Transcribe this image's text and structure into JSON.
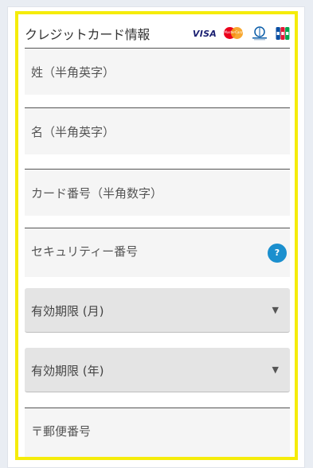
{
  "form": {
    "title": "クレジットカード情報",
    "card_brands": [
      "VISA",
      "MasterCard",
      "Diners Club",
      "JCB"
    ],
    "visa_text": "VISA",
    "mastercard_text": "MasterCard",
    "fields": {
      "last_name": "姓（半角英字）",
      "first_name": "名（半角英字）",
      "card_number": "カード番号（半角数字）",
      "security_code": "セキュリティー番号",
      "security_help": "?",
      "expiry_month": "有効期限 (月)",
      "expiry_year": "有効期限 (年)",
      "postal_code": "〒郵便番号"
    },
    "select_caret": "▼"
  },
  "colors": {
    "highlight_frame": "#f5ec0a",
    "help_badge": "#1b8fce",
    "field_bg": "#f5f5f5",
    "select_bg": "#e4e4e4"
  }
}
